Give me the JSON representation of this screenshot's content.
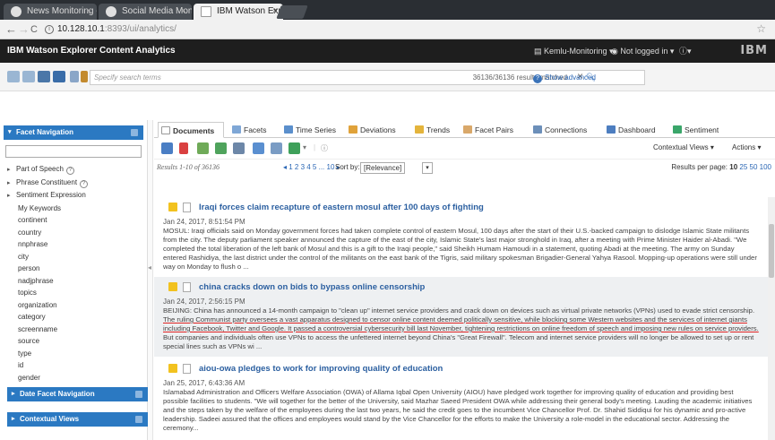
{
  "browser": {
    "tabs": [
      {
        "label": "News Monitoring - K",
        "active": false,
        "icon": "globe-icon"
      },
      {
        "label": "Social Media Monit",
        "active": false,
        "icon": "globe-icon"
      },
      {
        "label": "IBM Watson Explor",
        "active": true,
        "icon": "page-icon"
      }
    ],
    "url_host": "10.128.10.1",
    "url_path": ":8393/ui/analytics/"
  },
  "app": {
    "title": "IBM Watson Explorer Content Analytics",
    "collection": "Kemlu-Monitoring",
    "login": "Not logged in",
    "help": "?",
    "brand": "IBM"
  },
  "search": {
    "placeholder": "Specify search terms",
    "matched": "36136/36136 results matched",
    "show_advanced": "Show advanced"
  },
  "sidebar": {
    "header": "Facet Navigation",
    "tree_items": [
      {
        "label": "Part of Speech",
        "help": true
      },
      {
        "label": "Phrase Constituent",
        "help": true
      },
      {
        "label": "Sentiment Expression",
        "help": false
      }
    ],
    "items": [
      "My Keywords",
      "continent",
      "country",
      "nnphrase",
      "city",
      "person",
      "nadjphrase",
      "topics",
      "organization",
      "category",
      "screenname",
      "source",
      "type",
      "id",
      "gender"
    ],
    "date_header": "Date Facet Navigation",
    "contextual_header": "Contextual Views"
  },
  "tabs": [
    "Documents",
    "Facets",
    "Time Series",
    "Deviations",
    "Trends",
    "Facet Pairs",
    "Connections",
    "Dashboard",
    "Sentiment"
  ],
  "subtoolbar": {
    "contextual_views": "Contextual Views",
    "actions": "Actions"
  },
  "pager": {
    "results": "Results 1-10 of 36136",
    "pages": "◂ 1 2 3 4 5 ... 10 ▸",
    "sort_by": "Sort by:",
    "sort_value": "[Relevance]",
    "per_page_label": "Results per page:",
    "per_page_current": "10",
    "per_page_other": "25 50 100"
  },
  "results": [
    {
      "title": "Iraqi forces claim recapture of eastern mosul after 100 days of fighting",
      "date": "Jan 24, 2017, 8:51:54 PM",
      "body": "MOSUL: Iraqi officials said on Monday government forces had taken complete control of eastern Mosul, 100 days after the start of their U.S.-backed campaign to dislodge Islamic State militants from the city. The deputy parliament speaker announced the capture of the east of the city, Islamic State's last major stronghold in Iraq, after a meeting with Prime Minister Haider al-Abadi. \"We completed the total liberation of the left bank of Mosul and this is a gift to the Iraqi people,\" said Sheikh Humam Hamoudi in a statement, quoting Abadi at the meeting. The army on Sunday entered Rashidiya, the last district under the control of the militants on the east bank of the Tigris, said military spokesman Brigadier-General Yahya Rasool. Mopping-up operations were still under way on Monday to flush o ..."
    },
    {
      "title": "china cracks down on bids to bypass online censorship",
      "date": "Jan 24, 2017, 2:56:15 PM",
      "body_pre": "BEIJING: China has announced a 14-month campaign to \"clean up\" internet service providers and crack down on devices such as virtual private networks (VPNs) used to evade strict censorship. ",
      "body_underlined": "The ruling Communist party oversees a vast apparatus designed to censor online content deemed politically sensitive, while blocking some Western websites and the services of internet giants including Facebook, Twitter and Google. It passed a controversial cybersecurity bill last November, tightening restrictions on online freedom of speech and imposing new rules on service providers.",
      "body_post": " But companies and individuals often use VPNs to access the unfettered internet beyond China's \"Great Firewall\". Telecom and internet service providers will no longer be allowed to set up or rent special lines such as VPNs wi ..."
    },
    {
      "title": "aiou-owa pledges to work for improving quality of education",
      "date": "Jan 25, 2017, 6:43:36 AM",
      "body": "Islamabad Administration and Officers Welfare Association (OWA) of Allama Iqbal Open University (AIOU) have pledged work together for improving quality of education and providing best possible facilities to students. \"We will together for the better of the University, said Mazhar Saeed President OWA while addressing their general body's meeting. Lauding the academic initiatives and the steps taken by the welfare of the employees during the last two years, he said the credit goes to the incumbent Vice Chancellor Prof. Dr. Shahid Siddiqui for his dynamic and pro-active leadership. Sadeei assured that the offices and employees would stand by the Vice Chancellor for the efforts to make the University a role-model in the educational sector. Addressing the ceremony..."
    }
  ]
}
